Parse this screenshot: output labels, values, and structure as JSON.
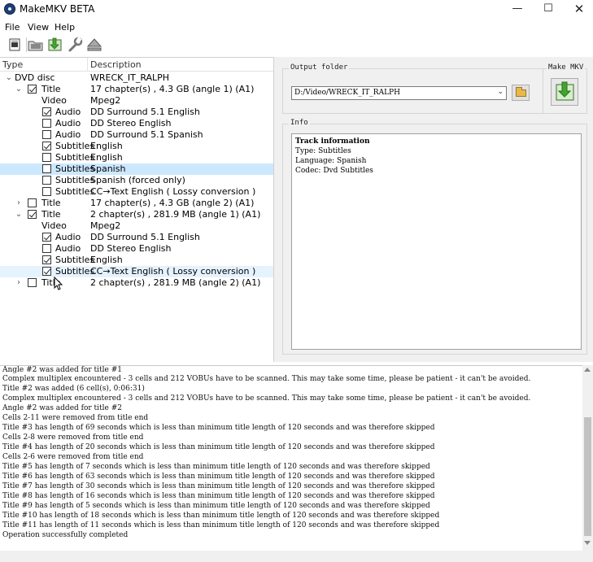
{
  "window": {
    "title": "MakeMKV BETA",
    "minimize": "—",
    "maximize": "☐",
    "close": "✕"
  },
  "menu": {
    "file": "File",
    "view": "View",
    "help": "Help"
  },
  "toolbar": {
    "icons": [
      "open-file-icon",
      "open-folder-icon",
      "backup-icon",
      "settings-wrench-icon",
      "eject-icon"
    ]
  },
  "tree": {
    "header": {
      "type": "Type",
      "description": "Description"
    },
    "rows": [
      {
        "type": "DVD disc",
        "description": "WRECK_IT_RALPH"
      },
      {
        "type": "Title",
        "description": "17 chapter(s) , 4.3 GB (angle 1) (A1)"
      },
      {
        "type": "Video",
        "description": "Mpeg2"
      },
      {
        "type": "Audio",
        "description": "DD Surround 5.1 English"
      },
      {
        "type": "Audio",
        "description": "DD Stereo English"
      },
      {
        "type": "Audio",
        "description": "DD Surround 5.1 Spanish"
      },
      {
        "type": "Subtitles",
        "description": "English"
      },
      {
        "type": "Subtitles",
        "description": "English"
      },
      {
        "type": "Subtitles",
        "description": "Spanish"
      },
      {
        "type": "Subtitles",
        "description": "Spanish  (forced only)"
      },
      {
        "type": "Subtitles",
        "description": "CC→Text English ( Lossy conversion )"
      },
      {
        "type": "Title",
        "description": "17 chapter(s) , 4.3 GB (angle 2) (A1)"
      },
      {
        "type": "Title",
        "description": "2 chapter(s) , 281.9 MB (angle 1) (A1)"
      },
      {
        "type": "Video",
        "description": "Mpeg2"
      },
      {
        "type": "Audio",
        "description": "DD Surround 5.1 English"
      },
      {
        "type": "Audio",
        "description": "DD Stereo English"
      },
      {
        "type": "Subtitles",
        "description": "English"
      },
      {
        "type": "Subtitles",
        "description": "CC→Text English ( Lossy conversion )"
      },
      {
        "type": "Title",
        "description": "2 chapter(s) , 281.9 MB (angle 2) (A1)"
      }
    ]
  },
  "output": {
    "label": "Output folder",
    "path": "D:/Video/WRECK_IT_RALPH",
    "make_label": "Make MKV"
  },
  "info": {
    "label": "Info",
    "lines": [
      "Track information",
      "Type: Subtitles",
      "Language: Spanish",
      "Codec: Dvd Subtitles"
    ]
  },
  "log": {
    "lines": [
      "Angle #2 was added for title #1",
      "Complex multiplex encountered - 3 cells and 212 VOBUs have to be scanned. This may take some time, please be patient - it can't be avoided.",
      "Title #2 was added (6 cell(s), 0:06:31)",
      "Complex multiplex encountered - 3 cells and 212 VOBUs have to be scanned. This may take some time, please be patient - it can't be avoided.",
      "Angle #2 was added for title #2",
      "Cells 2-11 were removed from title end",
      "Title #3 has length of 69 seconds which is less than minimum title length of 120 seconds and was therefore skipped",
      "Cells 2-8 were removed from title end",
      "Title #4 has length of 20 seconds which is less than minimum title length of 120 seconds and was therefore skipped",
      "Cells 2-6 were removed from title end",
      "Title #5 has length of 7 seconds which is less than minimum title length of 120 seconds and was therefore skipped",
      "Title #6 has length of 63 seconds which is less than minimum title length of 120 seconds and was therefore skipped",
      "Title #7 has length of 30 seconds which is less than minimum title length of 120 seconds and was therefore skipped",
      "Title #8 has length of 16 seconds which is less than minimum title length of 120 seconds and was therefore skipped",
      "Title #9 has length of 5 seconds which is less than minimum title length of 120 seconds and was therefore skipped",
      "Title #10 has length of 18 seconds which is less than minimum title length of 120 seconds and was therefore skipped",
      "Title #11 has length of 11 seconds which is less than minimum title length of 120 seconds and was therefore skipped",
      "Operation successfully completed"
    ]
  },
  "colors": {
    "selection": "#cce8ff",
    "hover": "#e5f3ff",
    "panel_bg": "#f0f0f0"
  }
}
